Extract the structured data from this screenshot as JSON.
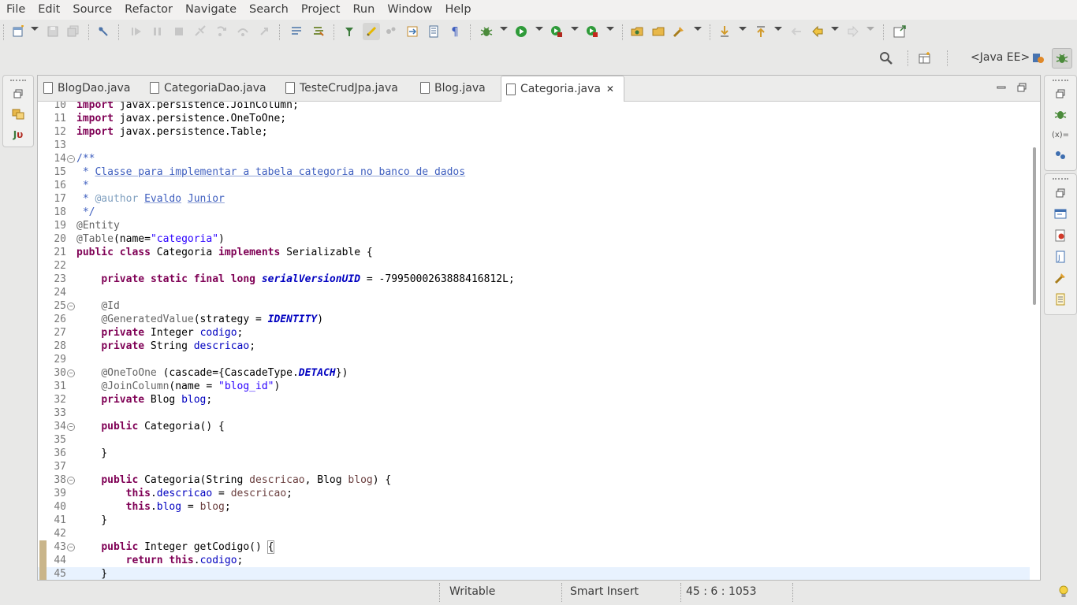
{
  "menubar": [
    "File",
    "Edit",
    "Source",
    "Refactor",
    "Navigate",
    "Search",
    "Project",
    "Run",
    "Window",
    "Help"
  ],
  "perspective": {
    "label": "<Java EE>"
  },
  "tabs": [
    {
      "label": "BlogDao.java",
      "active": false
    },
    {
      "label": "CategoriaDao.java",
      "active": false
    },
    {
      "label": "TesteCrudJpa.java",
      "active": false
    },
    {
      "label": "Blog.java",
      "active": false
    },
    {
      "label": "Categoria.java",
      "active": true,
      "close": "✕"
    }
  ],
  "code": {
    "current_line": 45,
    "lines": [
      {
        "n": 10,
        "html": "<span class=\"kw\">import</span> javax.persistence.JoinColumn;"
      },
      {
        "n": 11,
        "html": "<span class=\"kw\">import</span> javax.persistence.OneToOne;"
      },
      {
        "n": 12,
        "html": "<span class=\"kw\">import</span> javax.persistence.Table;"
      },
      {
        "n": 13,
        "html": ""
      },
      {
        "n": 14,
        "fold": true,
        "html": "<span class=\"jd\">/**</span>"
      },
      {
        "n": 15,
        "html": "<span class=\"jd\"> * </span><span class=\"jdu\">Classe para implementar a tabela categoria no banco de dados</span>"
      },
      {
        "n": 16,
        "html": "<span class=\"jd\"> *</span>"
      },
      {
        "n": 17,
        "html": "<span class=\"jd\"> * </span><span class=\"jdt\" style=\"font-weight:normal\">@author</span><span class=\"jd\"> </span><span class=\"jdu\">Evaldo</span><span class=\"jd\"> </span><span class=\"jdu\">Junior</span>"
      },
      {
        "n": 18,
        "html": "<span class=\"jd\"> */</span>"
      },
      {
        "n": 19,
        "html": "<span class=\"an\">@Entity</span>"
      },
      {
        "n": 20,
        "html": "<span class=\"an\">@Table</span>(name=<span class=\"st\">\"categoria\"</span>)"
      },
      {
        "n": 21,
        "html": "<span class=\"kw\">public</span> <span class=\"kw\">class</span> Categoria <span class=\"kw\">implements</span> Serializable {"
      },
      {
        "n": 22,
        "html": ""
      },
      {
        "n": 23,
        "html": "    <span class=\"kw\">private</span> <span class=\"kw\">static</span> <span class=\"kw\">final</span> <span class=\"kw\">long</span> <span class=\"sf\">serialVersionUID</span> = -7995000263888416812L;"
      },
      {
        "n": 24,
        "html": ""
      },
      {
        "n": 25,
        "fold": true,
        "html": "    <span class=\"an\">@Id</span>"
      },
      {
        "n": 26,
        "html": "    <span class=\"an\">@GeneratedValue</span>(strategy = <span class=\"sf\">IDENTITY</span>)"
      },
      {
        "n": 27,
        "html": "    <span class=\"kw\">private</span> Integer <span class=\"fd\">codigo</span>;"
      },
      {
        "n": 28,
        "html": "    <span class=\"kw\">private</span> String <span class=\"fd\">descricao</span>;"
      },
      {
        "n": 29,
        "html": ""
      },
      {
        "n": 30,
        "fold": true,
        "html": "    <span class=\"an\">@OneToOne</span> (cascade={CascadeType.<span class=\"sf\">DETACH</span>})"
      },
      {
        "n": 31,
        "html": "    <span class=\"an\">@JoinColumn</span>(name = <span class=\"st\">\"blog_id\"</span>)"
      },
      {
        "n": 32,
        "html": "    <span class=\"kw\">private</span> Blog <span class=\"fd\">blog</span>;"
      },
      {
        "n": 33,
        "html": ""
      },
      {
        "n": 34,
        "fold": true,
        "html": "    <span class=\"kw\">public</span> Categoria() {"
      },
      {
        "n": 35,
        "html": ""
      },
      {
        "n": 36,
        "html": "    }"
      },
      {
        "n": 37,
        "html": ""
      },
      {
        "n": 38,
        "fold": true,
        "html": "    <span class=\"kw\">public</span> Categoria(String <span style=\"color:#6a3e3e\">descricao</span>, Blog <span style=\"color:#6a3e3e\">blog</span>) {"
      },
      {
        "n": 39,
        "html": "        <span class=\"kw\">this</span>.<span class=\"fd\">descricao</span> = <span style=\"color:#6a3e3e\">descricao</span>;"
      },
      {
        "n": 40,
        "html": "        <span class=\"kw\">this</span>.<span class=\"fd\">blog</span> = <span style=\"color:#6a3e3e\">blog</span>;"
      },
      {
        "n": 41,
        "html": "    }"
      },
      {
        "n": 42,
        "html": ""
      },
      {
        "n": 43,
        "fold": true,
        "marker": true,
        "html": "    <span class=\"kw\">public</span> Integer getCodigo() <span class=\"bracket\">{</span>"
      },
      {
        "n": 44,
        "marker": true,
        "html": "        <span class=\"kw\">return</span> <span class=\"kw\">this</span>.<span class=\"fd\">codigo</span>;"
      },
      {
        "n": 45,
        "marker": true,
        "html": "    }"
      }
    ]
  },
  "status": {
    "mode": "Writable",
    "insert": "Smart Insert",
    "position": "45 : 6 : 1053"
  },
  "icons": [
    "new-icon",
    "save-icon",
    "save-all-icon",
    "skip-breakpoints-icon",
    "resume-icon",
    "suspend-icon",
    "terminate-icon",
    "disconnect-icon",
    "step-into-icon",
    "step-over-icon",
    "step-return-icon",
    "open-type-icon",
    "toggle-mark-occurrences-icon",
    "debug-icon",
    "run-icon",
    "coverage-icon",
    "external-tools-icon",
    "search-icon",
    "open-perspective-icon",
    "java-perspective-icon",
    "debug-perspective-icon",
    "tip-icon"
  ]
}
